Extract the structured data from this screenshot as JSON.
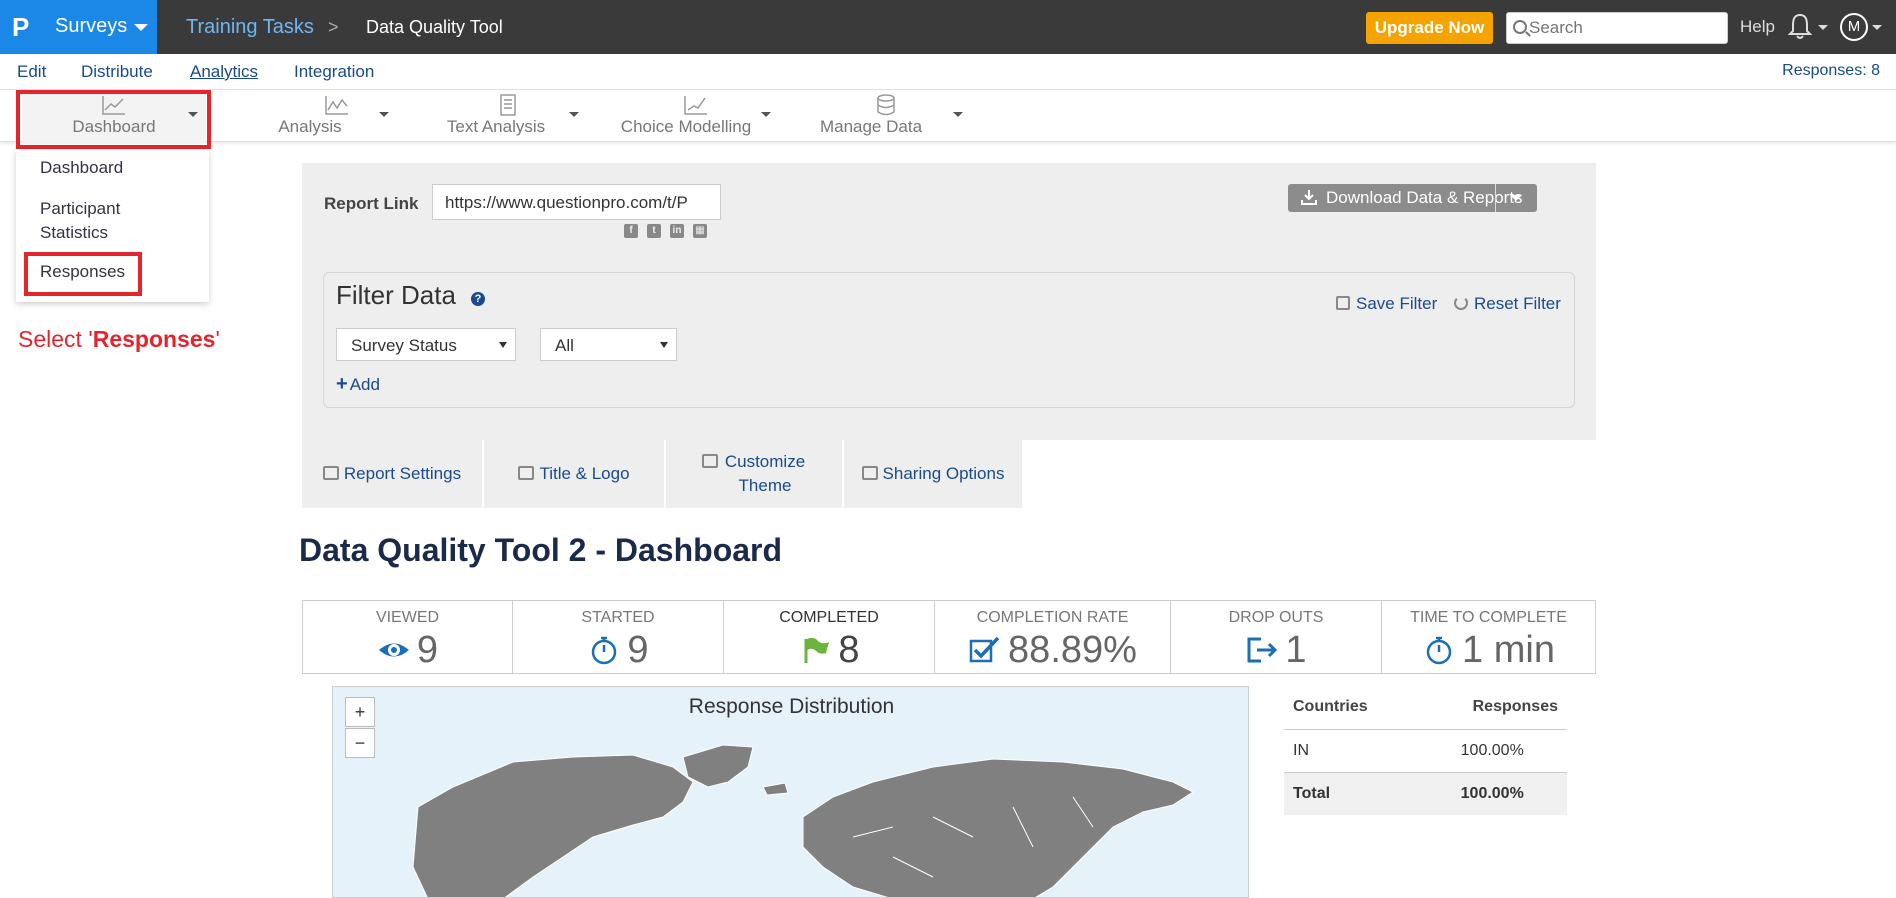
{
  "topbar": {
    "brand": "Surveys",
    "breadcrumb_parent": "Training Tasks",
    "breadcrumb_sep": ">",
    "breadcrumb_current": "Data Quality Tool",
    "upgrade_label": "Upgrade Now",
    "search_placeholder": "Search",
    "help_label": "Help",
    "avatar_initial": "M",
    "brand_color": "#1b87e6",
    "upgrade_color": "#f5a300"
  },
  "subnav": {
    "items": [
      "Edit",
      "Distribute",
      "Analytics",
      "Integration"
    ],
    "active": "Analytics",
    "responses_count": "Responses: 8"
  },
  "toolbar": {
    "tools": [
      {
        "label": "Dashboard",
        "icon": "line-chart-icon"
      },
      {
        "label": "Analysis",
        "icon": "analysis-chart-icon"
      },
      {
        "label": "Text Analysis",
        "icon": "document-icon"
      },
      {
        "label": "Choice Modelling",
        "icon": "trend-chart-icon"
      },
      {
        "label": "Manage Data",
        "icon": "database-icon"
      }
    ]
  },
  "dropdown": {
    "items": [
      "Dashboard",
      "Participant Statistics",
      "Responses"
    ]
  },
  "instruction": {
    "prefix": "Select '",
    "bold": "Responses",
    "suffix": "'",
    "color": "#e3262e"
  },
  "report": {
    "link_label": "Report Link",
    "link_value": "https://www.questionpro.com/t/P",
    "download_label": "Download Data & Reports"
  },
  "filter": {
    "title": "Filter Data",
    "save_label": "Save Filter",
    "reset_label": "Reset Filter",
    "field_select": "Survey Status",
    "value_select": "All",
    "add_label": "Add"
  },
  "tabs": [
    {
      "label": "Report Settings"
    },
    {
      "label": "Title & Logo"
    },
    {
      "label": "Customize Theme"
    },
    {
      "label": "Sharing Options"
    }
  ],
  "dashboard_title": "Data Quality Tool 2 - Dashboard",
  "stats": [
    {
      "label": "VIEWED",
      "value": "9",
      "icon": "eye-icon"
    },
    {
      "label": "STARTED",
      "value": "9",
      "icon": "stopwatch-icon"
    },
    {
      "label": "COMPLETED",
      "value": "8",
      "icon": "flag-icon"
    },
    {
      "label": "COMPLETION RATE",
      "value": "88.89%",
      "icon": "checkbox-icon"
    },
    {
      "label": "DROP OUTS",
      "value": "1",
      "icon": "exit-icon"
    },
    {
      "label": "TIME TO COMPLETE",
      "value": "1 min",
      "icon": "stopwatch-icon"
    }
  ],
  "map": {
    "title": "Response Distribution",
    "zoom_in": "+",
    "zoom_out": "−"
  },
  "country_table": {
    "headers": [
      "Countries",
      "Responses"
    ],
    "rows": [
      {
        "country": "IN",
        "pct": "100.00%"
      }
    ],
    "total_label": "Total",
    "total_pct": "100.00%"
  }
}
